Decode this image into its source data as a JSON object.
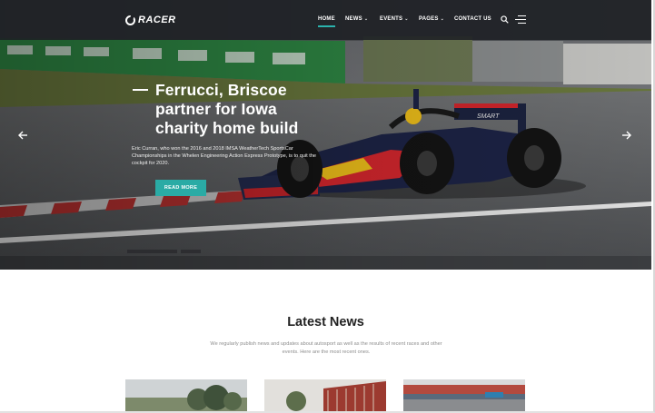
{
  "brand": {
    "logo_text": "RACER"
  },
  "nav": {
    "home": "HOME",
    "news": "NEWS",
    "events": "EVENTS",
    "pages": "PAGES",
    "contact": "CONTACT US",
    "dropdown_caret": "⌄"
  },
  "hero": {
    "headline": "Ferrucci, Briscoe partner for Iowa charity home build",
    "lede": "Eric Curran, who won the 2016 and 2018 IMSA WeatherTech SportsCar Championships in the Whelen Engineering Action Express Prototype, is to quit the cockpit for 2020.",
    "cta_label": "READ MORE",
    "prev_icon": "arrow-left-icon",
    "next_icon": "arrow-right-icon"
  },
  "latest": {
    "title": "Latest News",
    "subtitle": "We regularly publish news and updates about autosport as well as the results of recent races and other events. Here are the most recent ones."
  },
  "colors": {
    "accent": "#2aaba5",
    "topbar": "#1f2125",
    "text_dark": "#222222",
    "text_muted": "#8d8d8d"
  }
}
